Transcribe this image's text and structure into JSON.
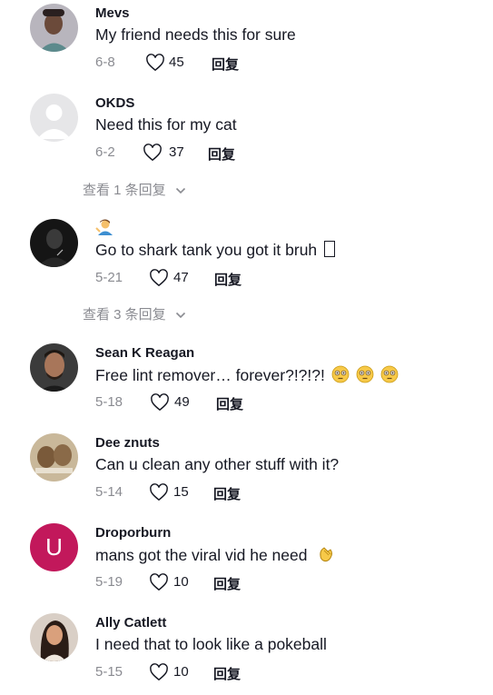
{
  "comments": [
    {
      "username": "Mevs",
      "text": "My friend needs this for sure",
      "date": "6-8",
      "likes": "45",
      "reply": "回复"
    },
    {
      "username": "OKDS",
      "text": "Need this for my cat",
      "date": "6-2",
      "likes": "37",
      "reply": "回复"
    },
    {
      "username": "",
      "text": "Go to shark tank you got it bruh",
      "date": "5-21",
      "likes": "47",
      "reply": "回复"
    },
    {
      "username": "Sean K Reagan",
      "text": "Free lint remover… forever?!?!?!",
      "date": "5-18",
      "likes": "49",
      "reply": "回复"
    },
    {
      "username": "Dee znuts",
      "text": "Can u clean any other stuff with it?",
      "date": "5-14",
      "likes": "15",
      "reply": "回复"
    },
    {
      "username": "Droporburn",
      "text": "mans got the viral vid he need",
      "date": "5-19",
      "likes": "10",
      "reply": "回复",
      "avatar_letter": "U"
    },
    {
      "username": "Ally Catlett",
      "text": "I need that to look like a pokeball",
      "date": "5-15",
      "likes": "10",
      "reply": "回复"
    }
  ],
  "view_replies": [
    {
      "label": "查看 1 条回复"
    },
    {
      "label": "查看 3 条回复"
    }
  ],
  "colors": {
    "muted": "#8a8b91",
    "text": "#161823",
    "avatar_letter_bg": "#c2185b"
  }
}
